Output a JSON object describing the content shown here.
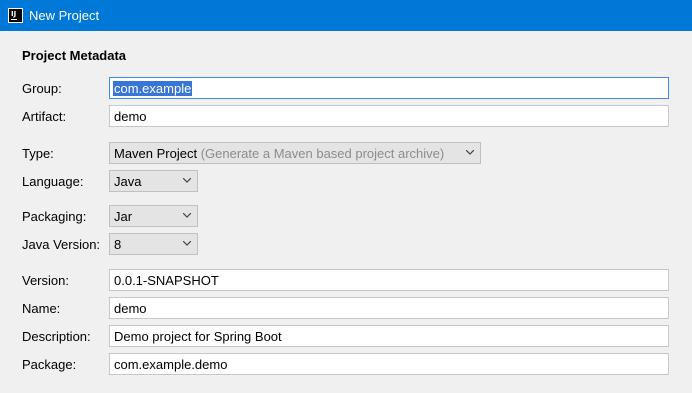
{
  "window": {
    "title": "New Project"
  },
  "section_title": "Project Metadata",
  "fields": {
    "group": {
      "label": "Group:",
      "value": "com.example"
    },
    "artifact": {
      "label": "Artifact:",
      "value": "demo"
    },
    "type": {
      "label": "Type:",
      "value": "Maven Project",
      "hint": "(Generate a Maven based project archive)"
    },
    "language": {
      "label": "Language:",
      "value": "Java"
    },
    "packaging": {
      "label": "Packaging:",
      "value": "Jar"
    },
    "java_version": {
      "label": "Java Version:",
      "value": "8"
    },
    "version": {
      "label": "Version:",
      "value": "0.0.1-SNAPSHOT"
    },
    "name": {
      "label": "Name:",
      "value": "demo"
    },
    "description": {
      "label": "Description:",
      "value": "Demo project for Spring Boot"
    },
    "package": {
      "label": "Package:",
      "value": "com.example.demo"
    }
  },
  "colors": {
    "titlebar": "#0078d7",
    "selection": "#3875d7"
  }
}
